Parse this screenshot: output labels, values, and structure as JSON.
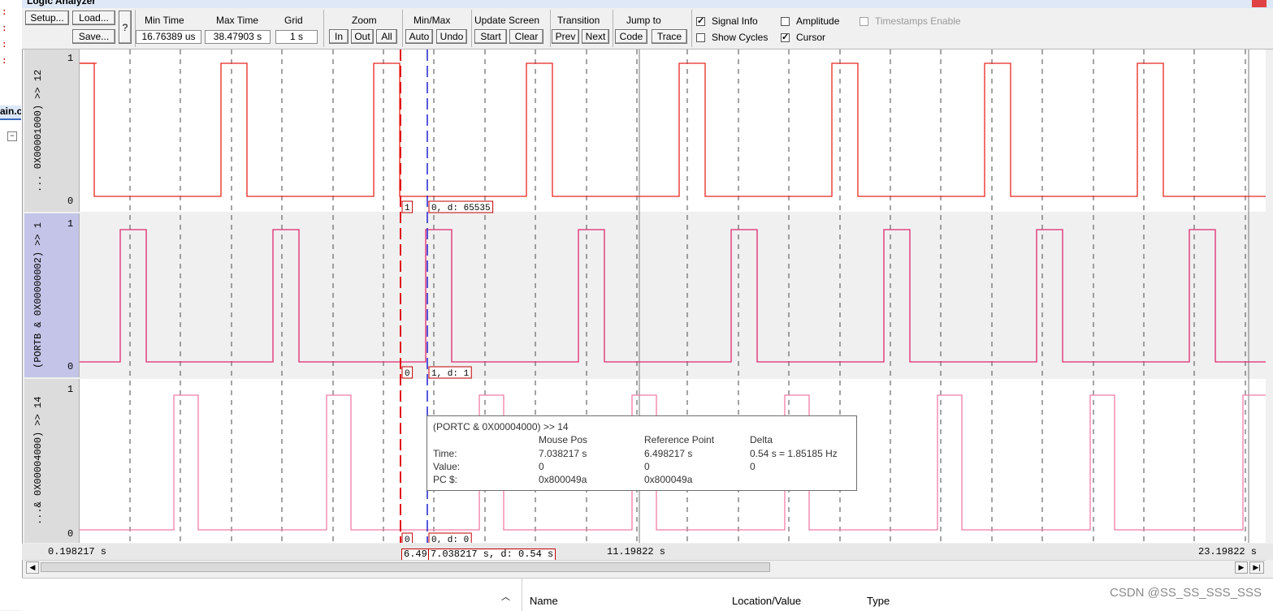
{
  "window": {
    "title": "Logic Analyzer"
  },
  "toolbar": {
    "setup": "Setup...",
    "load": "Load...",
    "save": "Save...",
    "help": "?",
    "min_time_label": "Min Time",
    "min_time": "16.76389 us",
    "max_time_label": "Max Time",
    "max_time": "38.47903 s",
    "grid_label": "Grid",
    "grid": "1 s",
    "zoom_label": "Zoom",
    "zoom_in": "In",
    "zoom_out": "Out",
    "zoom_all": "All",
    "minmax_label": "Min/Max",
    "auto": "Auto",
    "undo": "Undo",
    "update_label": "Update Screen",
    "start": "Start",
    "clear": "Clear",
    "transition_label": "Transition",
    "prev": "Prev",
    "next": "Next",
    "jump_label": "Jump to",
    "code": "Code",
    "trace": "Trace",
    "signal_info": "Signal Info",
    "amplitude": "Amplitude",
    "timestamps": "Timestamps Enable",
    "show_cycles": "Show Cycles",
    "cursor": "Cursor",
    "signal_info_checked": true,
    "amplitude_checked": false,
    "timestamps_checked": false,
    "show_cycles_checked": false,
    "cursor_checked": true
  },
  "signals": [
    {
      "name": "... 0X00001000) >> 12",
      "high": "1",
      "low": "0",
      "ref_val": "1",
      "cur_val": "0,  d: 65535"
    },
    {
      "name": "(PORTB & 0X00000002) >> 1",
      "high": "1",
      "low": "0",
      "ref_val": "0",
      "cur_val": "1,  d: 1"
    },
    {
      "name": "...& 0X00004000) >> 14",
      "high": "1",
      "low": "0",
      "ref_val": "0",
      "cur_val": "0,  d: 0"
    }
  ],
  "time_axis": {
    "start": "0.198217 s",
    "ref": "6.49",
    "cursor": "7.038217 s,   d: 0.54 s",
    "mid": "11.19822 s",
    "end": "23.19822 s"
  },
  "tooltip": {
    "title": "(PORTC & 0X00004000) >> 14",
    "col_mouse": "Mouse Pos",
    "col_ref": "Reference Point",
    "col_delta": "Delta",
    "row_time": "Time:",
    "row_value": "Value:",
    "row_pc": "PC $:",
    "time_mouse": "7.038217 s",
    "time_ref": "6.498217 s",
    "time_delta": "0.54 s = 1.85185 Hz",
    "value_mouse": "0",
    "value_ref": "0",
    "value_delta": "0",
    "pc_mouse": "0x800049a",
    "pc_ref": "0x800049a"
  },
  "bottom_panel": {
    "col_name": "Name",
    "col_location": "Location/Value",
    "col_type": "Type"
  },
  "left_strip": {
    "tab": "ain.c"
  },
  "watermark": "CSDN @SS_SS_SSS_SSS",
  "colors": {
    "wave1": "#e8261e",
    "wave2": "#e0286e",
    "wave3": "#f07ca8",
    "ref_cursor": "#e01010",
    "cursor": "#2020d0"
  }
}
